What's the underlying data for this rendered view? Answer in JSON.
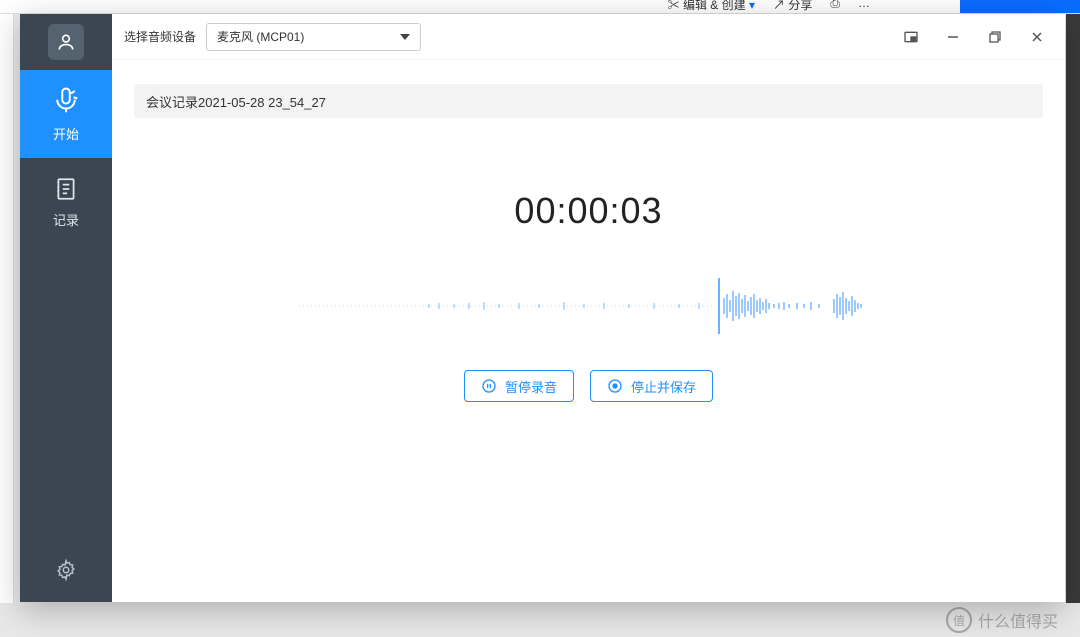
{
  "backdrop": {
    "edit_create": "编辑 & 创建",
    "share": "分享",
    "watermark": "什么值得买",
    "watermark_badge": "值"
  },
  "sidebar": {
    "start_label": "开始",
    "records_label": "记录"
  },
  "topbar": {
    "device_label": "选择音频设备",
    "device_selected": "麦克风 (MCP01)"
  },
  "content": {
    "filename": "会议记录2021-05-28 23_54_27",
    "timer": "00:00:03",
    "pause_label": "暂停录音",
    "stop_label": "停止并保存"
  }
}
